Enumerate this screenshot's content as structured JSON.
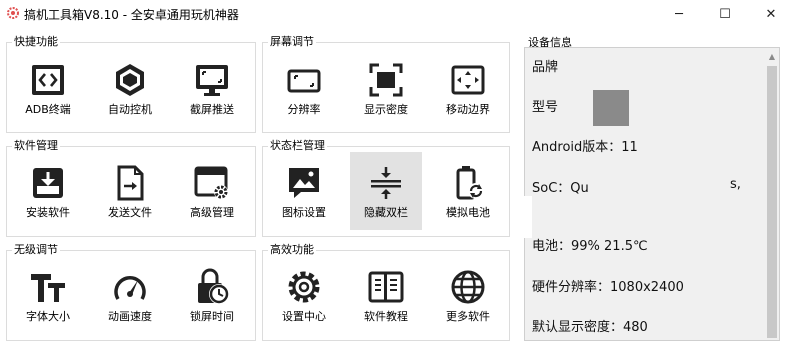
{
  "window": {
    "title": "搞机工具箱V8.10 - 全安卓通用玩机神器",
    "minimize": "─",
    "maximize": "☐",
    "close": "✕"
  },
  "groups": {
    "quick": {
      "title": "快捷功能",
      "items": [
        "ADB终端",
        "自动控机",
        "截屏推送"
      ]
    },
    "screen": {
      "title": "屏幕调节",
      "items": [
        "分辨率",
        "显示密度",
        "移动边界"
      ]
    },
    "software": {
      "title": "软件管理",
      "items": [
        "安装软件",
        "发送文件",
        "高级管理"
      ]
    },
    "statusbar": {
      "title": "状态栏管理",
      "items": [
        "图标设置",
        "隐藏双栏",
        "模拟电池"
      ]
    },
    "stepless": {
      "title": "无级调节",
      "items": [
        "字体大小",
        "动画速度",
        "锁屏时间"
      ]
    },
    "efficient": {
      "title": "高效功能",
      "items": [
        "设置中心",
        "软件教程",
        "更多软件"
      ]
    }
  },
  "device": {
    "title": "设备信息",
    "brand": "品牌",
    "model": "型号",
    "android": "Android版本：11",
    "soc": "SoC：Qu",
    "soc_tail": "s,",
    "battery": "电池：99%  21.5℃",
    "resolution": "硬件分辨率：1080x2400",
    "density": "默认显示密度：480"
  }
}
